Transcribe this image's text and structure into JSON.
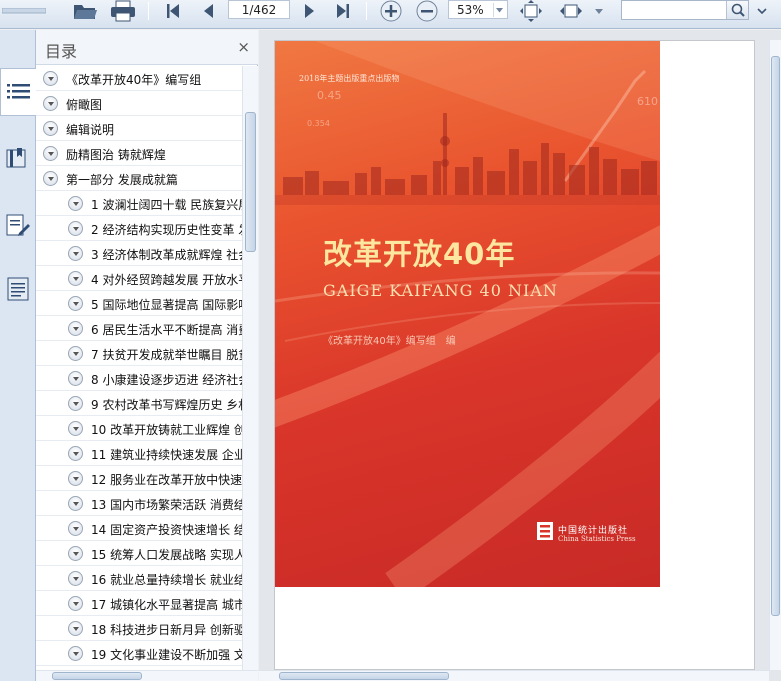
{
  "toolbar": {
    "page_indicator": "1/462",
    "zoom": "53%"
  },
  "outline": {
    "title": "目录",
    "close": "×",
    "items": [
      {
        "label": "《改革开放40年》编写组"
      },
      {
        "label": "俯瞰图"
      },
      {
        "label": "编辑说明"
      },
      {
        "label": "励精图治 铸就辉煌"
      },
      {
        "label": "第一部分 发展成就篇"
      },
      {
        "label": "1 波澜壮阔四十载 民族复兴展"
      },
      {
        "label": "2 经济结构实现历史性变革 发"
      },
      {
        "label": "3 经济体制改革成就辉煌 社会"
      },
      {
        "label": "4 对外经贸跨越发展 开放水平"
      },
      {
        "label": "5 国际地位显著提高 国际影响"
      },
      {
        "label": "6 居民生活水平不断提高 消费"
      },
      {
        "label": "7 扶贫开发成就举世瞩目 脱贫"
      },
      {
        "label": "8 小康建设逐步迈进 经济社会"
      },
      {
        "label": "9 农村改革书写辉煌历史 乡村"
      },
      {
        "label": "10 改革开放铸就工业辉煌 创"
      },
      {
        "label": "11 建筑业持续快速发展 企业"
      },
      {
        "label": "12 服务业在改革开放中快速"
      },
      {
        "label": "13 国内市场繁荣活跃 消费结"
      },
      {
        "label": "14 固定资产投资快速增长 结"
      },
      {
        "label": "15 统筹人口发展战略 实现人"
      },
      {
        "label": "16 就业总量持续增长 就业结"
      },
      {
        "label": "17 城镇化水平显著提高 城市"
      },
      {
        "label": "18 科技进步日新月异 创新驱"
      },
      {
        "label": "19 文化事业建设不断加强 文"
      }
    ]
  },
  "cover": {
    "tag": "2018年主题出版重点出版物",
    "title": "改革开放40年",
    "pinyin": "GAIGE KAIFANG 40 NIAN",
    "author": "《改革开放40年》编写组　编",
    "publisher_cn": "中国统计出版社",
    "publisher_en": "China Statistics Press",
    "bg_ticks": [
      "0.45",
      "0.354",
      "610"
    ]
  },
  "colors": {
    "cover_top": "#f07842",
    "cover_bottom": "#c82a26",
    "title_gold": "#fde6a0"
  }
}
